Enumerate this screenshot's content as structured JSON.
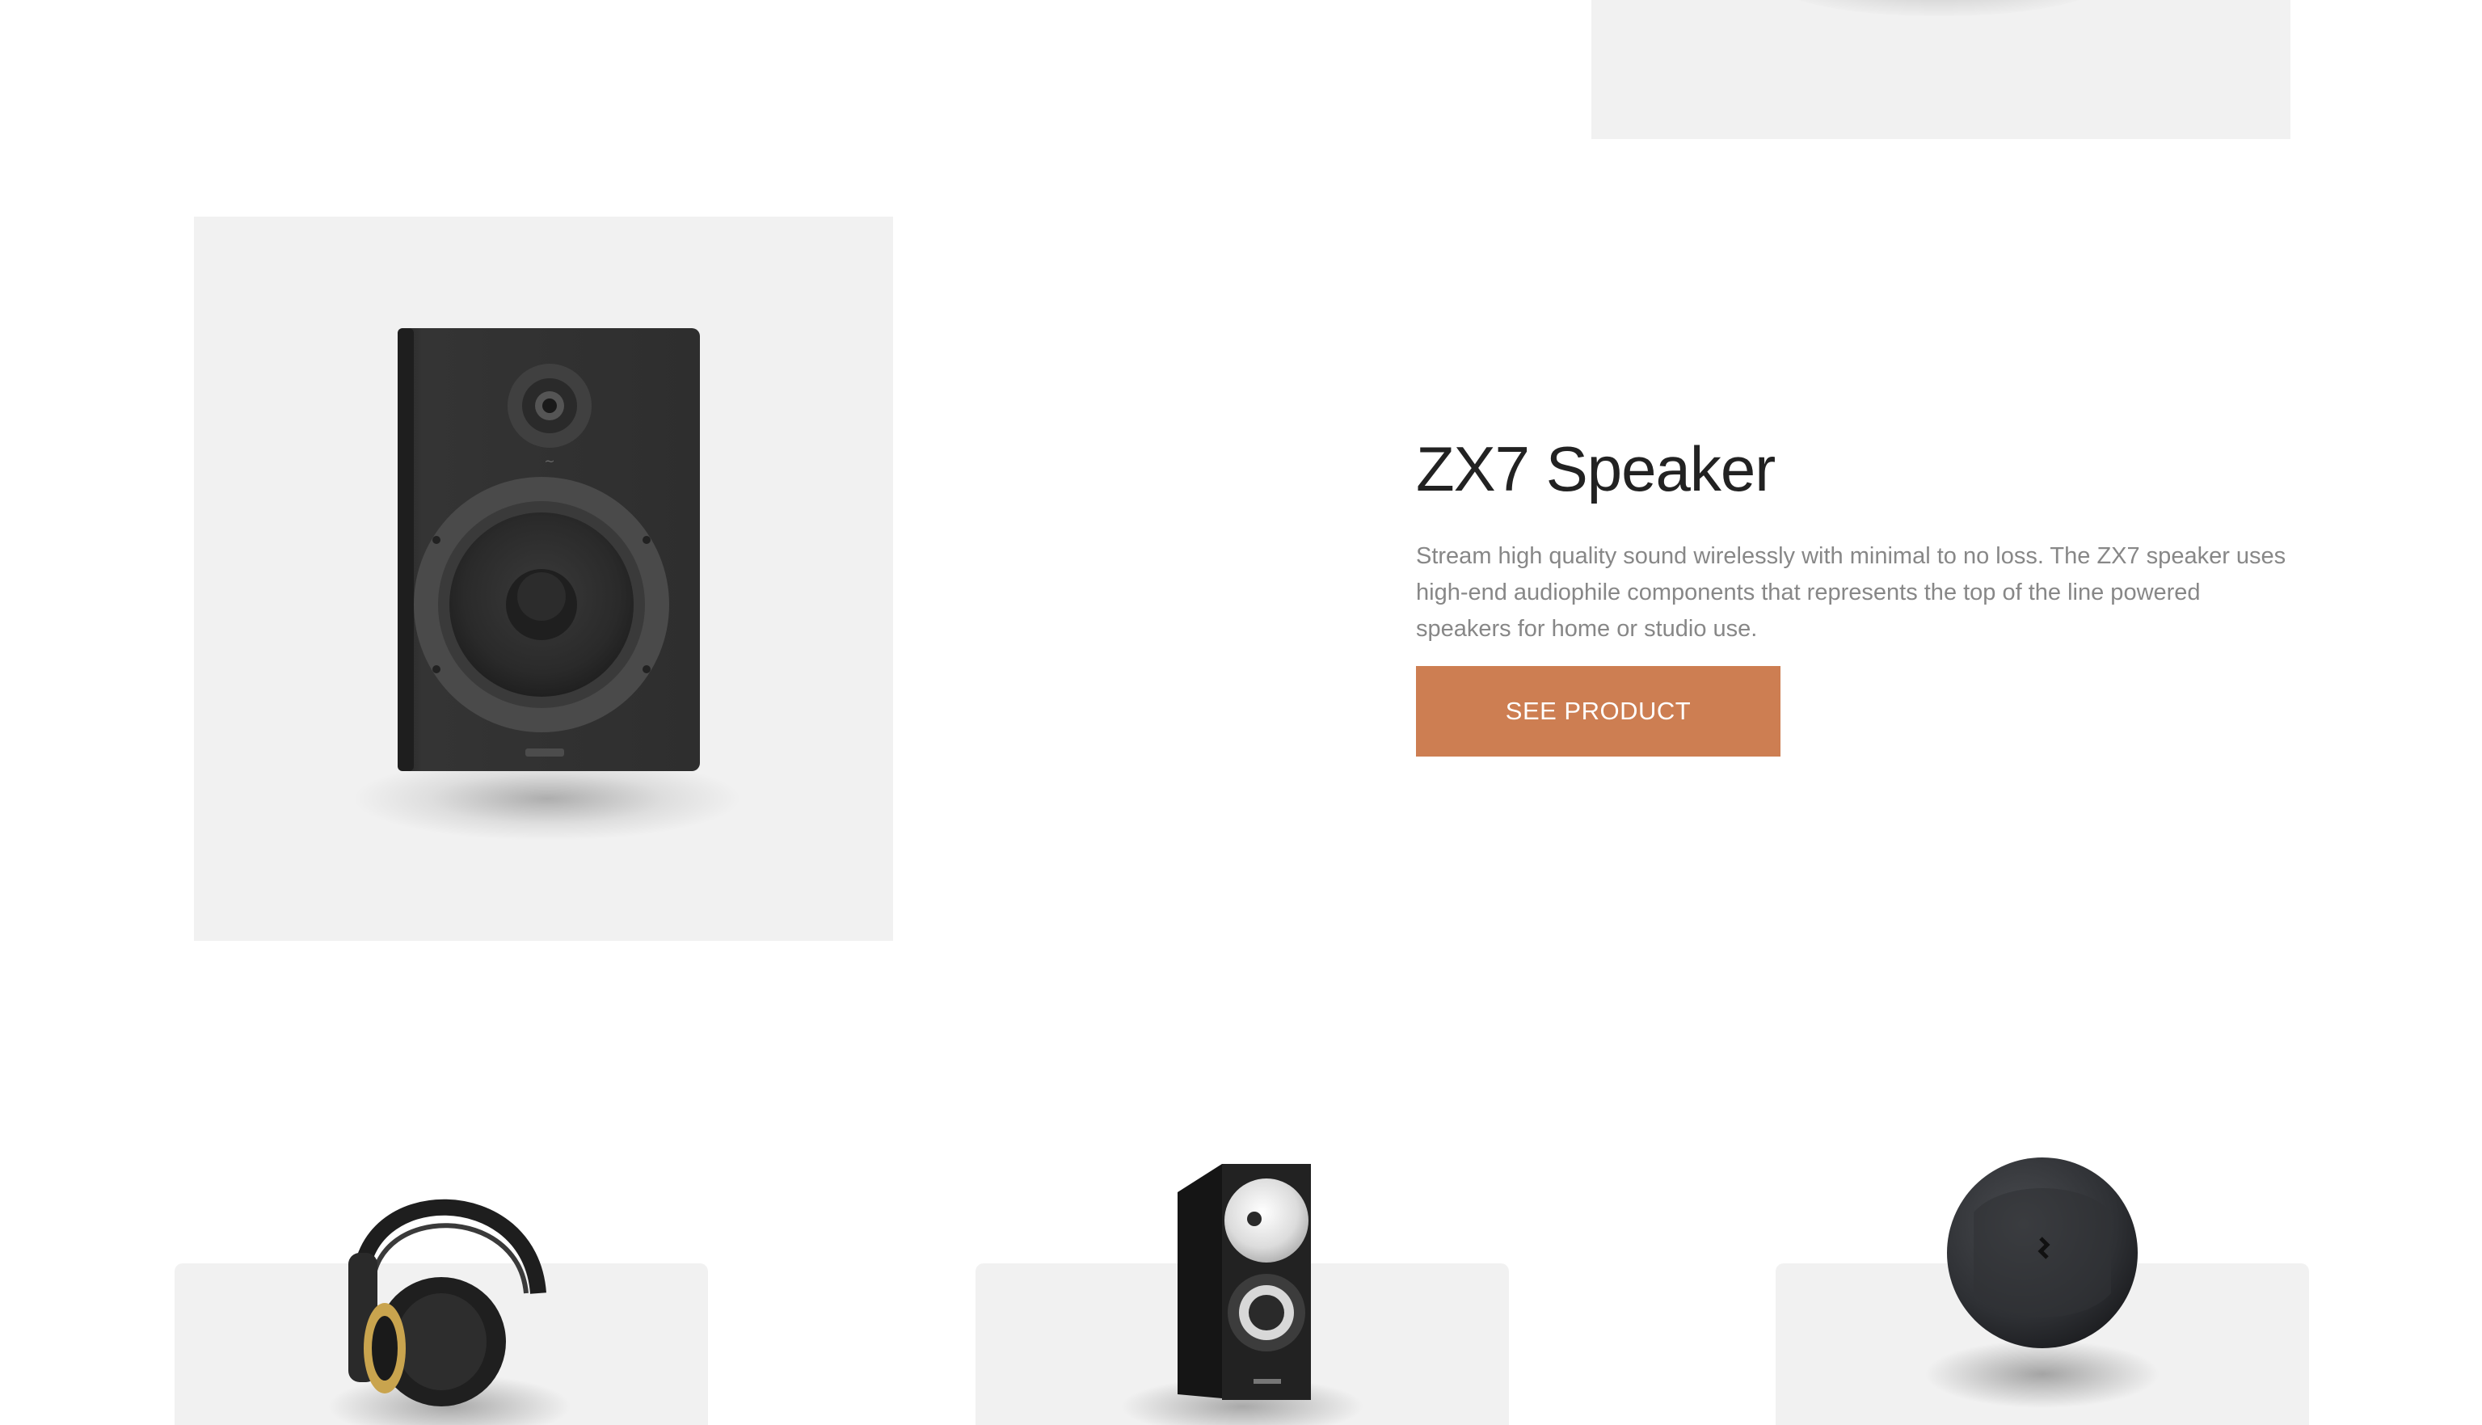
{
  "hero": {
    "title": "ZX7 Speaker",
    "description": "Stream high quality sound wirelessly with minimal to no loss. The ZX7 speaker uses high-end audiophile components that represents the top of the line powered speakers for home or studio use.",
    "button_label": "SEE PRODUCT",
    "image_icon": "speaker-icon"
  },
  "cards": [
    {
      "image_icon": "headphones-icon"
    },
    {
      "image_icon": "bookshelf-speaker-icon"
    },
    {
      "image_icon": "wireless-earphones-icon"
    }
  ],
  "colors": {
    "accent": "#cd7e52",
    "panel": "#f1f1f1",
    "title": "#222222",
    "body_text": "#878787"
  }
}
